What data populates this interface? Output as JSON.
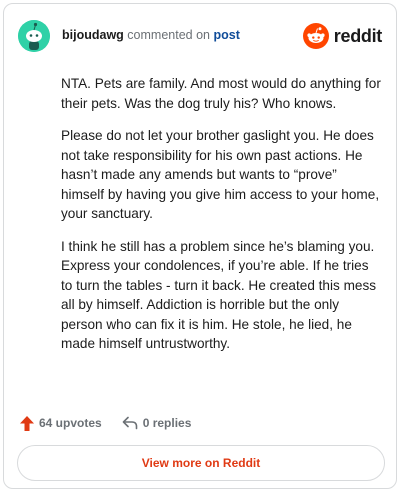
{
  "comment": {
    "username": "bijoudawg",
    "action_text": "commented on",
    "post_link": "post",
    "paragraphs": [
      "NTA. Pets are family. And most would do anything for their pets. Was the dog truly his? Who knows.",
      "Please do not let your brother gaslight you. He does not take responsibility for his own past actions. He hasn’t made any amends but wants to “prove” himself by having you give him access to your home, your sanctuary.",
      "I think he still has a problem since he’s blaming you. Express your condolences, if you’re able. If he tries to turn the tables - turn it back. He created this mess all by himself. Addiction is horrible but the only person who can fix it is him. He stole, he lied, he made himself untrustworthy."
    ]
  },
  "brand": {
    "name": "reddit"
  },
  "actions": {
    "upvotes": "64 upvotes",
    "replies": "0 replies"
  },
  "footer": {
    "view_more": "View more on Reddit"
  },
  "colors": {
    "avatar_bg": "#2fd1a7",
    "reddit_orange": "#ff4500",
    "upvote": "#e03a14",
    "link_blue": "#0f4c99"
  },
  "icons": {
    "avatar": "snoo-avatar-icon",
    "brand": "reddit-logo-icon",
    "upvote": "upvote-arrow-icon",
    "reply": "reply-arrow-icon"
  }
}
